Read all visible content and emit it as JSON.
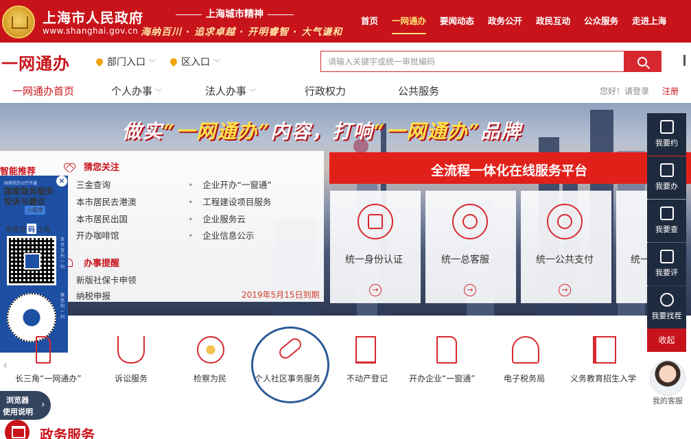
{
  "header": {
    "site_title": "上海市人民政府",
    "site_url": "www.shanghai.gov.cn",
    "spirit_title": "上海城市精神",
    "spirit_motto": "海纳百川 · 追求卓越 · 开明睿智 · 大气谦和",
    "nav": [
      "首页",
      "一网通办",
      "要闻动态",
      "政务公开",
      "政民互动",
      "公众服务",
      "走进上海"
    ],
    "active_nav": "一网通办"
  },
  "yiwang": {
    "logo": "一网通办",
    "dept_entry": "部门入口",
    "district_entry": "区入口",
    "search_placeholder": "请输入关键字或统一审批编码"
  },
  "subnav": {
    "items": [
      "一网通办首页",
      "个人办事",
      "法人办事",
      "行政权力",
      "公共服务"
    ],
    "login_text": "您好！请登录",
    "register": "注册"
  },
  "banner": {
    "slogan_part1": "做实",
    "slogan_q1": "“一网通办”",
    "slogan_part2": "内容，",
    "slogan_part3": "打响",
    "slogan_q2": "“一网通办”",
    "slogan_part4": "品牌"
  },
  "recommend": {
    "title": "智能推荐",
    "guess_title": "猜您关注",
    "guess_left": [
      "三金查询",
      "本市居民去港澳",
      "本市居民出国",
      "开办咖啡馆"
    ],
    "guess_right": [
      "企业开办“一窗通”",
      "工程建设项目服务",
      "企业服务云",
      "企业信息公示"
    ],
    "remind_title": "办事提醒",
    "remind_items": [
      "新版社保卡申领",
      "纳税申报"
    ],
    "due_text": "2019年5月15日到期"
  },
  "qr_panel": {
    "small_text": "国务院办公厅开通",
    "title_line1": "国家政务服务",
    "title_line2": "投诉与建议",
    "mini_tag": "小程序",
    "say_prefix": "有意见",
    "say_badge": "码",
    "say_suffix": "上说",
    "side_text_1": "支付宝扫一扫",
    "side_text_2": "微信扫一扫",
    "close": "×"
  },
  "platform": {
    "title": "全流程一体化在线服务平台",
    "cards": [
      "统一身份认证",
      "统一总客服",
      "统一公共支付",
      "统一"
    ]
  },
  "side_tools": {
    "items": [
      "我要约",
      "我要办",
      "我要查",
      "我要评",
      "我要找茬"
    ],
    "fold": "收起"
  },
  "quick_services": {
    "items": [
      "长三角“一网通办”",
      "诉讼服务",
      "检察为民",
      "个人社区事务服务",
      "不动产登记",
      "开办企业“一窗通”",
      "电子税务局",
      "义务教育招生入学"
    ]
  },
  "customer_service": {
    "label": "我的客服"
  },
  "browser_guide": {
    "line1": "浏览器",
    "line2": "使用说明"
  },
  "gov_services": {
    "title": "政务服务"
  },
  "colors": {
    "brand_red": "#c8131b",
    "accent_red": "#e2201a",
    "dark_tool": "#1e2a3d",
    "qr_blue": "#1d4fa3",
    "highlight": "#2a5a96"
  }
}
